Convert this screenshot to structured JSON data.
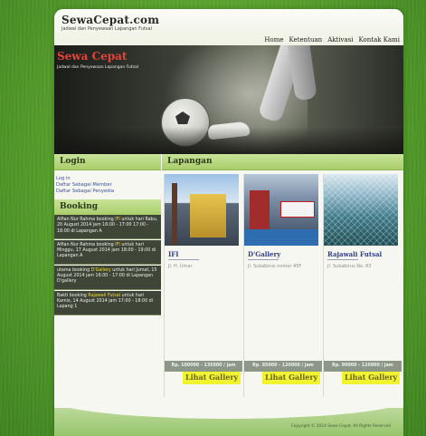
{
  "site": {
    "title": "SewaCepat.com",
    "tagline": "Jadwal dan Penyewaan Lapangan Futsal"
  },
  "nav": {
    "items": [
      "Home",
      "Ketentuan",
      "Aktivasi",
      "Kontak Kami"
    ]
  },
  "banner": {
    "title": "Sewa Cepat",
    "subtitle": "Jadwal dan Penyewaan Lapangan Futsal"
  },
  "login": {
    "heading": "Login",
    "links": [
      "Log in",
      "Daftar Sebagai Member",
      "Daftar Sebagai Penyedia"
    ]
  },
  "booking": {
    "heading": "Booking",
    "items": [
      {
        "pre": "Alfian Nur Rahma booking ",
        "venue": "IFI",
        "post": " untuk hari Rabu, 20 August 2014 jam 16:00 - 17:00 17:00 - 18:00 di Lapangan A"
      },
      {
        "pre": "Alfian Nur Rahma booking ",
        "venue": "IFI",
        "post": " untuk hari Minggu, 17 August 2014 jam 18:00 - 19:00 di Lapangan A"
      },
      {
        "pre": "utama booking ",
        "venue": "D'Gallery",
        "post": " untuk hari Jumat, 15 August 2014 jam 16:00 - 17:00 di Lapangan D'gallery"
      },
      {
        "pre": "Bakti booking ",
        "venue": "Rajawali Futsal",
        "post": " untuk hari Kamis, 14 August 2014 jam 17:00 - 18:00 di Lapang 1"
      }
    ]
  },
  "lapangan": {
    "heading": "Lapangan",
    "venues": [
      {
        "name": "IFI",
        "address": "Jl. H. Umar",
        "price": "Rp. 100000 - 135000 / jam",
        "button": "Lihat Gallery"
      },
      {
        "name": "D'Gallery",
        "address": "Jl. Sukabirus nomor 45F",
        "price": "Rp. 85000 - 120000 / jam",
        "button": "Lihat Gallery"
      },
      {
        "name": "Rajawali Futsal",
        "address": "Jl. Sukabirus No. 83",
        "price": "Rp. 90000 - 120000 / jam",
        "button": "Lihat Gallery"
      }
    ]
  },
  "footer": {
    "copyright": "Copyright © 2014 Sewa Cepat. All Rights Reserved"
  },
  "colors": {
    "accent_red": "#e6433a",
    "section_green": "#a9cd6a",
    "booking_dark": "#3f4638",
    "highlight_yellow": "#f2f330"
  }
}
